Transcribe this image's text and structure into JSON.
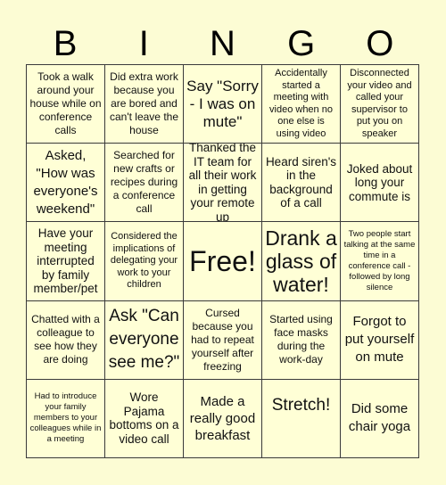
{
  "header": {
    "letters": [
      "B",
      "I",
      "N",
      "G",
      "O"
    ]
  },
  "cells": [
    [
      "Took a walk around your house while on conference calls",
      "Did extra work because you are bored and can't leave the house",
      "Say \"Sorry - I was on mute\"",
      "Accidentally started a meeting with video when no one else is using video",
      "Disconnected your video and called your supervisor to put you on speaker"
    ],
    [
      "Asked, \"How was everyone's weekend\"",
      "Searched for new crafts or recipes during a conference call",
      "Thanked the IT team for all their work in getting your remote up",
      "Heard siren's in the background of a call",
      "Joked about long your commute is"
    ],
    [
      "Have your meeting interrupted by family member/pet",
      "Considered the implications of delegating your work to your children",
      "Free!",
      "Drank a glass of water!",
      "Two people start talking at the same time in a conference call - followed by long silence"
    ],
    [
      "Chatted with a colleague to see how they are doing",
      "Ask \"Can everyone see me?\"",
      "Cursed because you had to repeat yourself after freezing",
      "Started using face masks during the work-day",
      "Forgot to put yourself on mute"
    ],
    [
      "Had to introduce your family members to your colleagues while in a meeting",
      "Wore Pajama bottoms on a video call",
      "Made a really good breakfast",
      "Stretch!",
      "Did some chair yoga"
    ]
  ],
  "free_space": {
    "row": 2,
    "col": 2,
    "label": "Free!"
  }
}
